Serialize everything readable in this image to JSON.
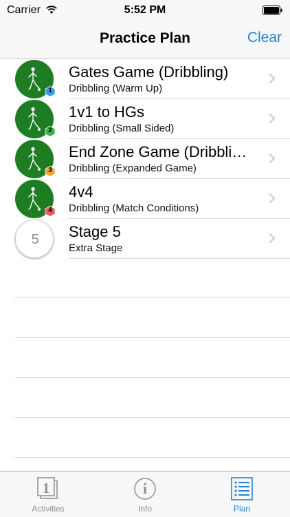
{
  "status_bar": {
    "carrier": "Carrier",
    "time": "5:52 PM"
  },
  "nav": {
    "title": "Practice Plan",
    "clear_label": "Clear"
  },
  "colors": {
    "accent": "#2a84d0",
    "avatar_green": "#1e7d22",
    "badge_colors": [
      "#3a9ee0",
      "#3fb34a",
      "#f0a33a",
      "#e35b5b"
    ]
  },
  "stages": [
    {
      "title": "Gates Game (Dribbling)",
      "subtitle": "Dribbling (Warm Up)",
      "badge": "1",
      "icon": "player-icon"
    },
    {
      "title": "1v1 to HGs",
      "subtitle": "Dribbling (Small Sided)",
      "badge": "2",
      "icon": "player-icon"
    },
    {
      "title": "End Zone Game (Dribbli…",
      "subtitle": "Dribbling (Expanded Game)",
      "badge": "3",
      "icon": "player-icon"
    },
    {
      "title": "4v4",
      "subtitle": "Dribbling (Match Conditions)",
      "badge": "4",
      "icon": "player-icon"
    },
    {
      "title": "Stage 5",
      "subtitle": "Extra Stage",
      "number": "5"
    }
  ],
  "tabs": [
    {
      "label": "Activities",
      "icon": "activities-icon",
      "icon_text": "1",
      "active": false
    },
    {
      "label": "Info",
      "icon": "info-icon",
      "icon_text": "i",
      "active": false
    },
    {
      "label": "Plan",
      "icon": "plan-icon",
      "active": true
    }
  ]
}
